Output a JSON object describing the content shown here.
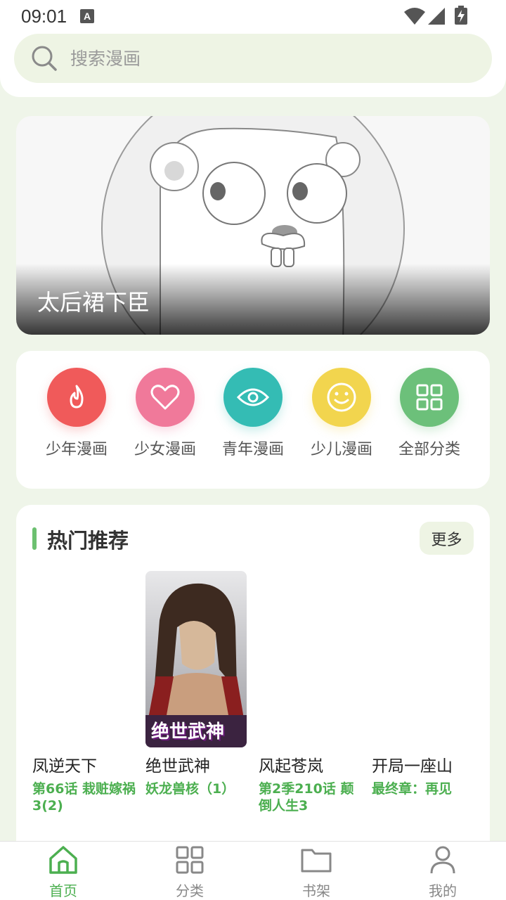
{
  "status": {
    "time": "09:01",
    "a_badge": "A"
  },
  "search": {
    "placeholder": "搜索漫画"
  },
  "banner": {
    "title": "太后裙下臣"
  },
  "categories": [
    {
      "label": "少年漫画",
      "color": "#f05a5a",
      "icon": "flame-icon"
    },
    {
      "label": "少女漫画",
      "color": "#f0799a",
      "icon": "heart-icon"
    },
    {
      "label": "青年漫画",
      "color": "#34bcb4",
      "icon": "eye-icon"
    },
    {
      "label": "少儿漫画",
      "color": "#f2d54e",
      "icon": "smile-icon"
    },
    {
      "label": "全部分类",
      "color": "#6cc07a",
      "icon": "grid-icon"
    }
  ],
  "hot": {
    "heading": "热门推荐",
    "more_label": "更多",
    "items": [
      {
        "name": "凤逆天下",
        "chapter": "第66话 栽赃嫁祸3(2)"
      },
      {
        "name": "绝世武神",
        "chapter": "妖龙兽核（1）",
        "cover_text": "绝世武神"
      },
      {
        "name": "风起苍岚",
        "chapter": "第2季210话 颠倒人生3"
      },
      {
        "name": "开局一座山",
        "chapter": "最终章：再见"
      }
    ]
  },
  "nav": [
    {
      "label": "首页",
      "icon": "home-icon",
      "active": true
    },
    {
      "label": "分类",
      "icon": "grid-icon"
    },
    {
      "label": "书架",
      "icon": "folder-icon"
    },
    {
      "label": "我的",
      "icon": "person-icon"
    }
  ],
  "accent": "#4caf50"
}
